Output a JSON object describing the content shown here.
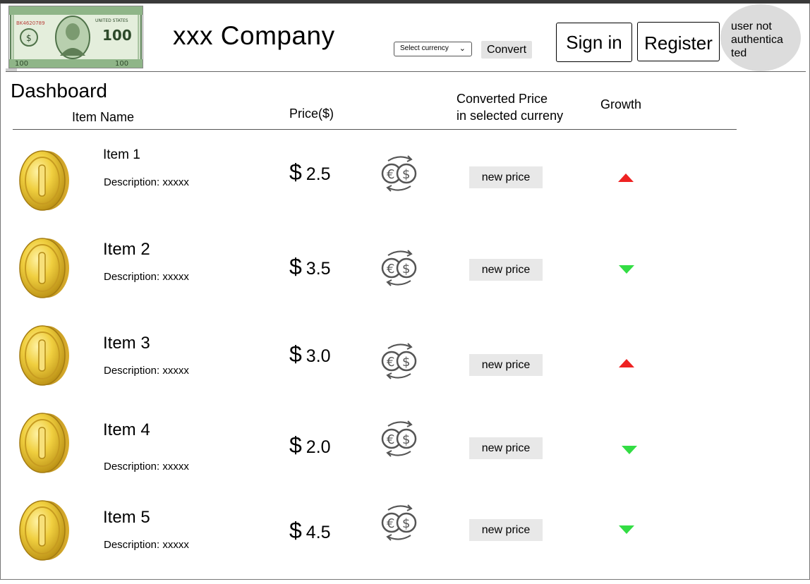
{
  "header": {
    "company": "xxx Company",
    "currency_placeholder": "Select currency",
    "convert_label": "Convert",
    "signin_label": "Sign in",
    "register_label": "Register",
    "user_status_lines": [
      "user not",
      "authentica",
      "ted"
    ],
    "logo_icon": "hundred-dollar-bill-icon"
  },
  "dashboard": {
    "title": "Dashboard",
    "columns": {
      "item_name": "Item Name",
      "price": "Price($)",
      "converted_line1": "Converted Price",
      "converted_line2": "in selected curreny",
      "growth": "Growth"
    },
    "items": [
      {
        "name": "Item 1",
        "description": "Description: xxxxx",
        "currency_symbol": "$",
        "price": "2.5",
        "converted": "new price",
        "growth": "up"
      },
      {
        "name": "Item 2",
        "description": "Description: xxxxx",
        "currency_symbol": "$",
        "price": "3.5",
        "converted": "new price",
        "growth": "down"
      },
      {
        "name": "Item 3",
        "description": "Description: xxxxx",
        "currency_symbol": "$",
        "price": "3.0",
        "converted": "new price",
        "growth": "up"
      },
      {
        "name": "Item 4",
        "description": "Description: xxxxx",
        "currency_symbol": "$",
        "price": "2.0",
        "converted": "new price",
        "growth": "down"
      },
      {
        "name": "Item 5",
        "description": "Description: xxxxx",
        "currency_symbol": "$",
        "price": "4.5",
        "converted": "new price",
        "growth": "down"
      }
    ]
  },
  "icons": {
    "coin": "gold-coin-icon",
    "exchange": "euro-dollar-exchange-icon",
    "growth_up": "triangle-up-icon",
    "growth_down": "triangle-down-icon"
  },
  "colors": {
    "growth_up": "#ee2222",
    "growth_down": "#33dd44",
    "coin_gold": "#e5c23a",
    "bill_green": "#6f9a6a"
  }
}
